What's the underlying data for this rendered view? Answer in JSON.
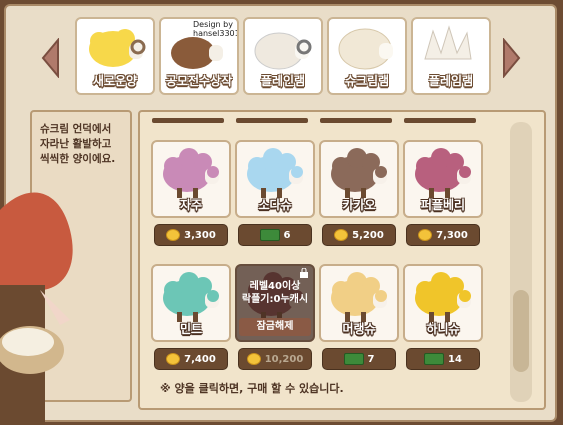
{
  "tabs": [
    {
      "label": "새로운양",
      "color": "#f7d84a"
    },
    {
      "label": "공모전수상작",
      "color": "#8a5b3a",
      "credit": "Design by\nhansel3301"
    },
    {
      "label": "플레인램",
      "color": "#efe9df"
    },
    {
      "label": "슈크림램",
      "color": "#f1e8d6"
    },
    {
      "label": "플레임램",
      "color": "#f4efe6"
    }
  ],
  "description": "슈크림 언덕에서 자라난 활발하고 씩씩한 양이에요.",
  "items": [
    {
      "name": "자주",
      "price": "3,300",
      "currency": "coin",
      "color": "#c98ab7"
    },
    {
      "name": "소다슈",
      "price": "6",
      "currency": "cash",
      "color": "#a9d7ef"
    },
    {
      "name": "카카오",
      "price": "5,200",
      "currency": "coin",
      "color": "#8b6a5a"
    },
    {
      "name": "퍼플베리",
      "price": "7,300",
      "currency": "coin",
      "color": "#b8607e"
    },
    {
      "name": "민트",
      "price": "7,400",
      "currency": "coin",
      "color": "#6cc6b6"
    },
    {
      "name": "",
      "price": "10,200",
      "currency": "coin",
      "color": "#8a4a5a",
      "locked": true,
      "lock_text": "레벨40이상\n락플기:0누캐시",
      "unlock_label": "잠금해제"
    },
    {
      "name": "머랭슈",
      "price": "7",
      "currency": "cash",
      "color": "#f1cf86"
    },
    {
      "name": "하니슈",
      "price": "14",
      "currency": "cash",
      "color": "#f0c52a"
    }
  ],
  "footer_note": "※ 양을 클릭하면, 구매 할 수 있습니다."
}
